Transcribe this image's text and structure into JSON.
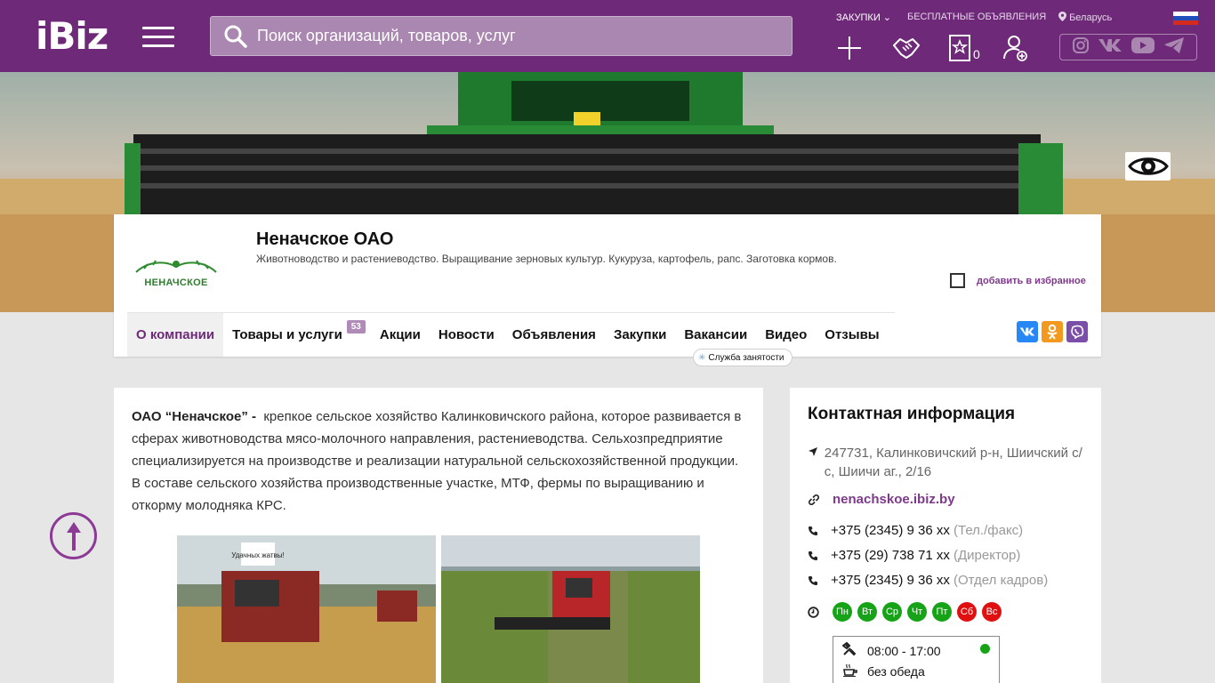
{
  "brand": {
    "logo_text": "iBiz"
  },
  "search": {
    "placeholder": "Поиск организаций, товаров, услуг"
  },
  "top_links": {
    "purchases": "ЗАКУПКИ",
    "free_ads": "БЕСПЛАТНЫЕ ОБЪЯВЛЕНИЯ",
    "region": "Беларусь"
  },
  "header": {
    "favorites_count": "0"
  },
  "company": {
    "name": "Неначское ОАО",
    "description": "Животноводство и растениеводство. Выращивание зерновых культур. Кукуруза, картофель, рапс. Заготовка кормов.",
    "logo_text": "НЕНАЧСКОЕ",
    "add_favorite": "добавить в избранное"
  },
  "nav": {
    "items": [
      {
        "label": "О компании"
      },
      {
        "label": "Товары и услуги",
        "badge": "53"
      },
      {
        "label": "Акции"
      },
      {
        "label": "Новости"
      },
      {
        "label": "Объявления"
      },
      {
        "label": "Закупки"
      },
      {
        "label": "Вакансии"
      },
      {
        "label": "Видео"
      },
      {
        "label": "Отзывы"
      }
    ],
    "tooltip": "Служба занятости"
  },
  "share": {
    "vk": "VK",
    "ok": "OK",
    "viber": "Viber"
  },
  "about": {
    "lead": "ОАО “Неначское” -",
    "text": "крепкое сельское хозяйство Калинковичского района, которое развивается в сферах животноводства мясо-молочного направления, растениеводства. Сельхозпредприятие специализируется на производстве и реализации натуральной сельскохозяйственной продукции. В составе сельского хозяйства производственные участке, МТФ, фермы по выращиванию и откорму молодняка КРС.",
    "photo1_sign": "Удачных жатвы!"
  },
  "contacts": {
    "title": "Контактная информация",
    "address": "247731, Калинковичский р-н, Шиичский с/с, Шиичи аг., 2/16",
    "website": "nenachskoe.ibiz.by",
    "phones": [
      {
        "number": "+375 (2345) 9 36 xx",
        "note": "(Тел./факс)"
      },
      {
        "number": "+375 (29) 738 71 xx",
        "note": "(Директор)"
      },
      {
        "number": "+375 (2345) 9 36 xx",
        "note": "(Отдел кадров)"
      }
    ],
    "days": [
      {
        "label": "Пн",
        "color": "#17a317"
      },
      {
        "label": "Вт",
        "color": "#17a317"
      },
      {
        "label": "Ср",
        "color": "#17a317"
      },
      {
        "label": "Чт",
        "color": "#17a317"
      },
      {
        "label": "Пт",
        "color": "#17a317"
      },
      {
        "label": "Сб",
        "color": "#e01010"
      },
      {
        "label": "Вс",
        "color": "#e01010"
      }
    ],
    "hours": "08:00 - 17:00",
    "lunch": "без обеда"
  },
  "colors": {
    "brand": "#6e2a78",
    "accent": "#7d3a8a",
    "open": "#17a317",
    "closed": "#e01010"
  }
}
